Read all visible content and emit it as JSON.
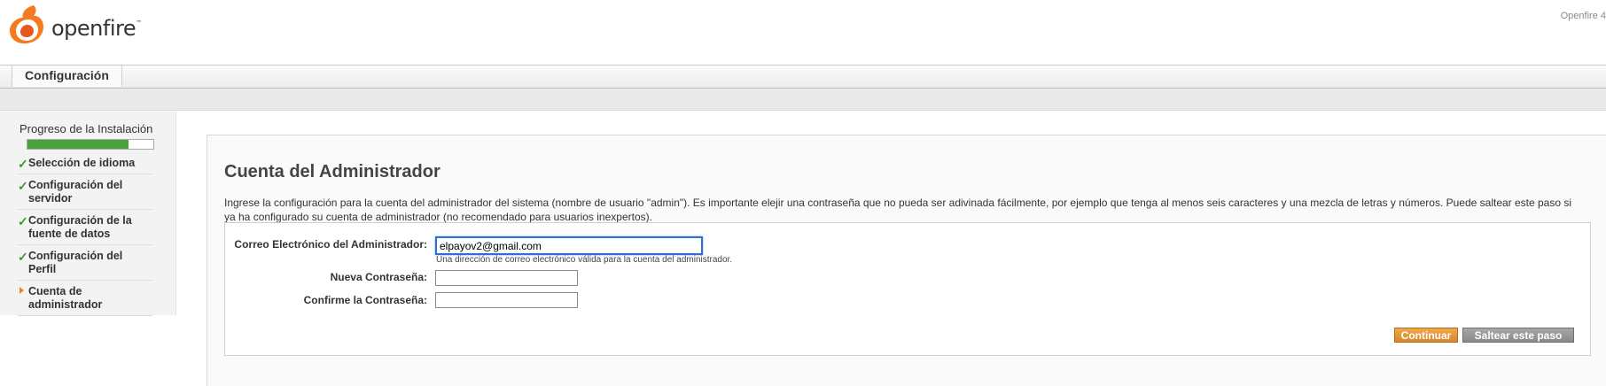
{
  "header": {
    "logo_text": "openfire",
    "logo_tm": "™",
    "right_text": "Openfire 4"
  },
  "nav": {
    "tabs": [
      {
        "label": "Configuración"
      }
    ]
  },
  "sidebar": {
    "title": "Progreso de la Instalación",
    "progress_percent": 80,
    "items": [
      {
        "label": "Selección de idioma",
        "status": "done"
      },
      {
        "label": "Configuración del servidor",
        "status": "done"
      },
      {
        "label": "Configuración de la fuente de datos",
        "status": "done"
      },
      {
        "label": "Configuración del Perfil",
        "status": "done"
      },
      {
        "label": "Cuenta de administrador",
        "status": "current"
      }
    ]
  },
  "main": {
    "title": "Cuenta del Administrador",
    "intro": "Ingrese la configuración para la cuenta del administrador del sistema (nombre de usuario \"admin\"). Es importante elejir una contraseña que no pueda ser adivinada fácilmente, por ejemplo que tenga al menos seis caracteres y una mezcla de letras y números. Puede saltear este paso si ya ha configurado su cuenta de administrador (no recomendado para usuarios inexpertos).",
    "form": {
      "email_label": "Correo Electrónico del Administrador:",
      "email_value": "elpayov2@gmail.com",
      "email_hint": "Una dirección de correo electrónico válida para la cuenta del administrador.",
      "password_label": "Nueva Contraseña:",
      "password_value": "",
      "confirm_label": "Confirme la Contraseña:",
      "confirm_value": ""
    },
    "buttons": {
      "continue_label": "Continuar",
      "skip_label": "Saltear este paso"
    }
  },
  "colors": {
    "accent_orange": "#e08a1e",
    "check_green": "#3a9a2a",
    "focus_blue": "#2d6fd6"
  }
}
